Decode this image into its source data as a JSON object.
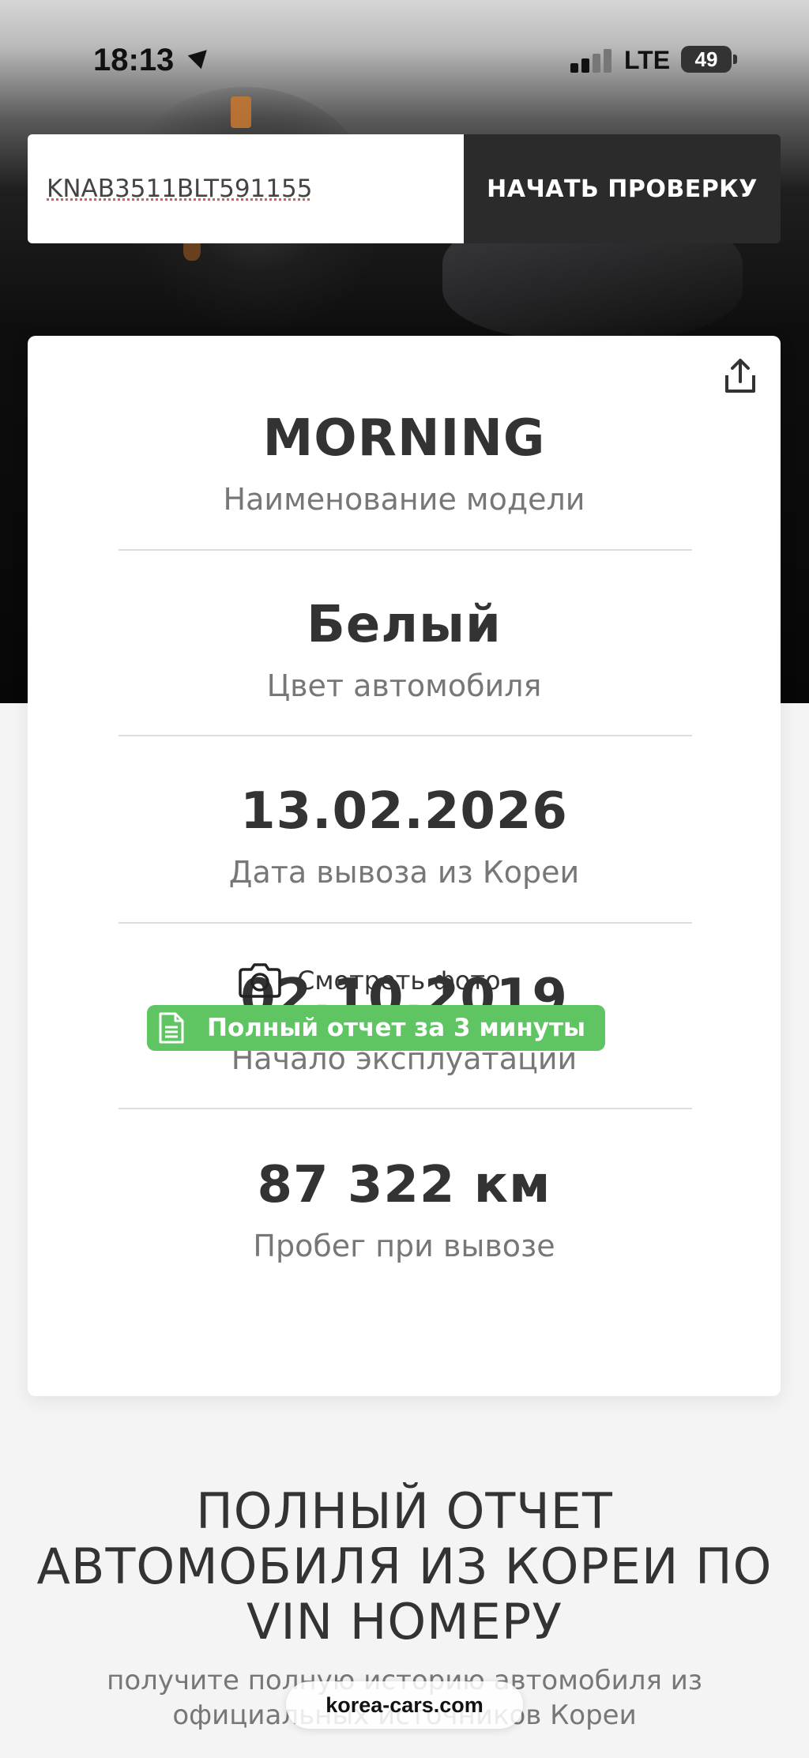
{
  "status_bar": {
    "time": "18:13",
    "network": "LTE",
    "battery": "49"
  },
  "search": {
    "vin_value": "KNAB3511BLT591155",
    "button_label": "НАЧАТЬ ПРОВЕРКУ"
  },
  "car_info": {
    "model": {
      "value": "MORNING",
      "label": "Наименование модели"
    },
    "color": {
      "value": "Белый",
      "label": "Цвет автомобиля"
    },
    "export_date": {
      "value": "13.02.2026",
      "label": "Дата вывоза из Кореи"
    },
    "start_date": {
      "value": "02.10.2019",
      "label": "Начало эксплуатации"
    },
    "mileage": {
      "value": "87 322 км",
      "label": "Пробег при вывозе"
    },
    "photo_link": "Смотреть фото",
    "report_badge": "Полный отчет за 3 минуты"
  },
  "promo": {
    "title_line1": "ПОЛНЫЙ ОТЧЕТ",
    "title_line2": "АВТОМОБИЛЯ ИЗ КОРЕИ ПО",
    "title_line3": "VIN НОМЕРУ",
    "subtitle_line1": "получите полную историю автомобиля из",
    "subtitle_line2": "официальных источников Кореи"
  },
  "browser": {
    "url": "korea-cars.com"
  },
  "icons": {
    "location": "location-arrow-icon",
    "signal": "signal-icon",
    "battery": "battery-icon",
    "share": "share-icon",
    "camera": "camera-icon",
    "document": "document-icon"
  },
  "colors": {
    "accent_green": "#5fc563",
    "button_dark": "#2b2b2b",
    "text_dark": "#333333",
    "text_muted": "#777777"
  }
}
